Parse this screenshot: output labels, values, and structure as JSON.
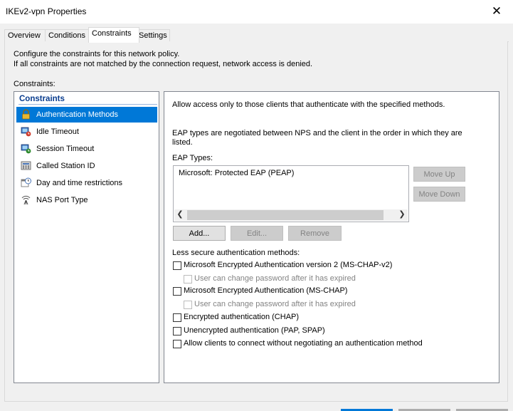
{
  "window": {
    "title": "IKEv2-vpn Properties"
  },
  "tabs": [
    "Overview",
    "Conditions",
    "Constraints",
    "Settings"
  ],
  "intro": {
    "line1": "Configure the constraints for this network policy.",
    "line2": "If all constraints are not matched by the connection request, network access is denied."
  },
  "constraints_label": "Constraints:",
  "tree": {
    "header": "Constraints",
    "items": [
      {
        "label": "Authentication Methods",
        "icon": "lock-icon",
        "selected": true
      },
      {
        "label": "Idle Timeout",
        "icon": "idle-timeout-icon"
      },
      {
        "label": "Session Timeout",
        "icon": "session-timeout-icon"
      },
      {
        "label": "Called Station ID",
        "icon": "phone-icon"
      },
      {
        "label": "Day and time restrictions",
        "icon": "calendar-clock-icon"
      },
      {
        "label": "NAS Port Type",
        "icon": "antenna-icon"
      }
    ]
  },
  "right": {
    "desc": "Allow access only to those clients that authenticate with the specified methods.",
    "eap_desc1": "EAP types are negotiated between NPS and the client in the order in which they are",
    "eap_desc2": "listed.",
    "eap_types_label": "EAP Types:",
    "eap_types": [
      "Microsoft: Protected EAP (PEAP)"
    ],
    "move_up": "Move Up",
    "move_down": "Move Down",
    "add": "Add...",
    "edit": "Edit...",
    "remove": "Remove",
    "less_secure_label": "Less secure authentication methods:",
    "methods": [
      "Microsoft Encrypted Authentication version 2 (MS-CHAP-v2)",
      "User can change password after it has expired",
      "Microsoft Encrypted Authentication (MS-CHAP)",
      "User can change password after it has expired",
      "Encrypted authentication (CHAP)",
      "Unencrypted authentication (PAP, SPAP)",
      "Allow clients to connect without negotiating an authentication method"
    ]
  },
  "colors": {
    "accent": "#0078d7",
    "tree_header": "#0a3d8f"
  }
}
